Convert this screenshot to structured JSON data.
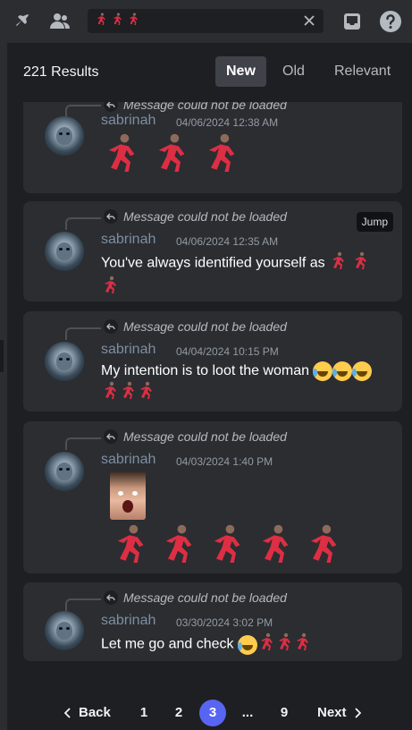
{
  "toolbar": {
    "search_query_glyphs": [
      "🏃🏽‍♀️",
      "🏃🏽‍♀️",
      "🏃🏽‍♀️"
    ],
    "icons": [
      "pin-icon",
      "members-icon",
      "clear-icon",
      "inbox-icon",
      "help-icon"
    ]
  },
  "results": {
    "count_label": "221 Results",
    "sort": {
      "new": "New",
      "old": "Old",
      "relevant": "Relevant",
      "selected": "New"
    }
  },
  "messages": [
    {
      "reply_text": "Message could not be loaded",
      "username": "sabrinah",
      "timestamp": "04/06/2024 12:38 AM",
      "text": "",
      "trailing_runners": 3,
      "has_jump": false
    },
    {
      "reply_text": "Message could not be loaded",
      "username": "sabrinah",
      "timestamp": "04/06/2024 12:35 AM",
      "text": "You've always identified yourself as",
      "trailing_runners": 3,
      "has_jump": true,
      "jump_label": "Jump"
    },
    {
      "reply_text": "Message could not be loaded",
      "username": "sabrinah",
      "timestamp": "04/04/2024 10:15 PM",
      "text": "My intention is to loot the woman",
      "laughs": 3,
      "trailing_runners": 3,
      "has_jump": false
    },
    {
      "reply_text": "Message could not be loaded",
      "username": "sabrinah",
      "timestamp": "04/03/2024 1:40 PM",
      "text": "",
      "has_photo": true,
      "trailing_runners": 5,
      "has_jump": false
    },
    {
      "reply_text": "Message could not be loaded",
      "username": "sabrinah",
      "timestamp": "03/30/2024 3:02 PM",
      "text": "Let me go and check",
      "laughs": 1,
      "trailing_runners": 3,
      "has_jump": false
    }
  ],
  "pagination": {
    "back_label": "Back",
    "next_label": "Next",
    "pages": [
      "1",
      "2",
      "3",
      "...",
      "9"
    ],
    "current": "3"
  },
  "colors": {
    "accent": "#5865f2",
    "username": "#7d8fa3",
    "card_bg": "#2b2d31",
    "page_bg": "#1e1f22"
  }
}
